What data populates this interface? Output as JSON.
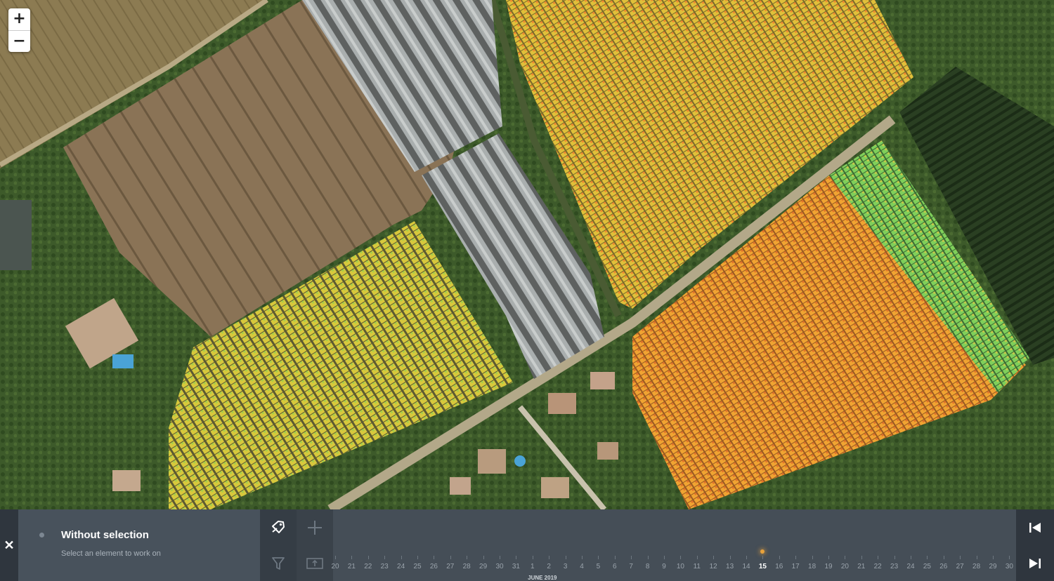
{
  "map": {
    "zoom_in": "+",
    "zoom_out": "−"
  },
  "panel": {
    "close_label": "✕",
    "selection_title": "Without selection",
    "selection_subtitle": "Select an element to work on",
    "tools": [
      "tag-icon",
      "plus-icon",
      "filter-icon",
      "upload-icon"
    ],
    "navigation": [
      "skip-first-icon",
      "skip-next-icon"
    ]
  },
  "timeline": {
    "days_prev": [
      "20",
      "21",
      "22",
      "23",
      "24",
      "25",
      "26",
      "27",
      "28",
      "29",
      "30",
      "31"
    ],
    "days_current": [
      "1",
      "2",
      "3",
      "4",
      "5",
      "6",
      "7",
      "8",
      "9",
      "10",
      "11",
      "12",
      "13",
      "14",
      "15",
      "16",
      "17",
      "18",
      "19",
      "20",
      "21",
      "22",
      "23",
      "24",
      "25",
      "26",
      "27",
      "28",
      "29",
      "30"
    ],
    "month_label": "JUNE 2019",
    "active_day": "15",
    "marker_color": "#e8a23b"
  },
  "colors": {
    "panel_bg": "#3d4650",
    "panel_selection_bg": "#48525c",
    "panel_dark": "#2f363e",
    "solar_yellow": "#d7c63a",
    "solar_orange": "#f0a030",
    "solar_green": "#7fcf5a"
  }
}
